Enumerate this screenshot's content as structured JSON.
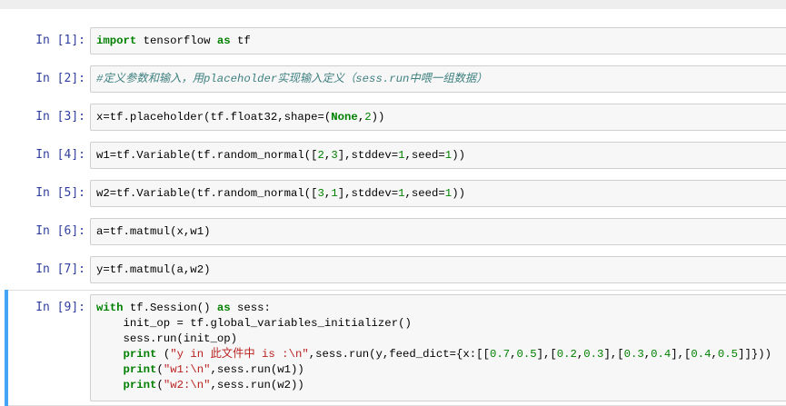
{
  "cells": [
    {
      "prompt": "In [1]:",
      "code": [
        [
          [
            "import",
            "kw"
          ],
          [
            " tensorflow ",
            ""
          ],
          [
            "as",
            "kw"
          ],
          [
            " tf",
            ""
          ]
        ]
      ]
    },
    {
      "prompt": "In [2]:",
      "code": [
        [
          [
            "#定义参数和输入，用placeholder实现输入定义（sess.run中喂一组数据）",
            "cm"
          ]
        ]
      ]
    },
    {
      "prompt": "In [3]:",
      "code": [
        [
          [
            "x=tf.placeholder(tf.float32,shape=(",
            ""
          ],
          [
            "None",
            "kw"
          ],
          [
            ",",
            ""
          ],
          [
            "2",
            "num"
          ],
          [
            "))",
            ""
          ]
        ]
      ]
    },
    {
      "prompt": "In [4]:",
      "code": [
        [
          [
            "w1=tf.Variable(tf.random_normal([",
            ""
          ],
          [
            "2",
            "num"
          ],
          [
            ",",
            ""
          ],
          [
            "3",
            "num"
          ],
          [
            "],stddev=",
            ""
          ],
          [
            "1",
            "num"
          ],
          [
            ",seed=",
            ""
          ],
          [
            "1",
            "num"
          ],
          [
            "))",
            ""
          ]
        ]
      ]
    },
    {
      "prompt": "In [5]:",
      "code": [
        [
          [
            "w2=tf.Variable(tf.random_normal([",
            ""
          ],
          [
            "3",
            "num"
          ],
          [
            ",",
            ""
          ],
          [
            "1",
            "num"
          ],
          [
            "],stddev=",
            ""
          ],
          [
            "1",
            "num"
          ],
          [
            ",seed=",
            ""
          ],
          [
            "1",
            "num"
          ],
          [
            "))",
            ""
          ]
        ]
      ]
    },
    {
      "prompt": "In [6]:",
      "code": [
        [
          [
            "a=tf.matmul(x,w1)",
            ""
          ]
        ]
      ]
    },
    {
      "prompt": "In [7]:",
      "code": [
        [
          [
            "y=tf.matmul(a,w2)",
            ""
          ]
        ]
      ]
    },
    {
      "prompt": "In [9]:",
      "selected": true,
      "code": [
        [
          [
            "with",
            "kw"
          ],
          [
            " tf.Session() ",
            ""
          ],
          [
            "as",
            "kw"
          ],
          [
            " sess:",
            ""
          ]
        ],
        [
          [
            "    init_op = tf.global_variables_initializer()",
            ""
          ]
        ],
        [
          [
            "    sess.run(init_op)",
            ""
          ]
        ],
        [
          [
            "    ",
            ""
          ],
          [
            "print",
            "kw"
          ],
          [
            " (",
            ""
          ],
          [
            "\"y in 此文件中 is :\\n\"",
            "str"
          ],
          [
            ",sess.run(y,feed_dict={x:[[",
            ""
          ],
          [
            "0.7",
            "num"
          ],
          [
            ",",
            ""
          ],
          [
            "0.5",
            "num"
          ],
          [
            "],[",
            ""
          ],
          [
            "0.2",
            "num"
          ],
          [
            ",",
            ""
          ],
          [
            "0.3",
            "num"
          ],
          [
            "],[",
            ""
          ],
          [
            "0.3",
            "num"
          ],
          [
            ",",
            ""
          ],
          [
            "0.4",
            "num"
          ],
          [
            "],[",
            ""
          ],
          [
            "0.4",
            "num"
          ],
          [
            ",",
            ""
          ],
          [
            "0.5",
            "num"
          ],
          [
            "]]}))",
            ""
          ]
        ],
        [
          [
            "    ",
            ""
          ],
          [
            "print",
            "kw"
          ],
          [
            "(",
            ""
          ],
          [
            "\"w1:\\n\"",
            "str"
          ],
          [
            ",sess.run(w1))",
            ""
          ]
        ],
        [
          [
            "    ",
            ""
          ],
          [
            "print",
            "kw"
          ],
          [
            "(",
            ""
          ],
          [
            "\"w2:\\n\"",
            "str"
          ],
          [
            ",sess.run(w2))",
            ""
          ]
        ]
      ]
    }
  ]
}
